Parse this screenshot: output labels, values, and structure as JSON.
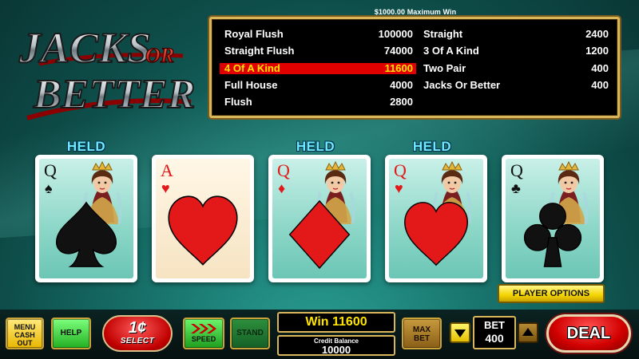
{
  "game": {
    "logo_line1": "JACKS",
    "logo_or": "OR",
    "logo_line2": "BETTER",
    "max_win": "$1000.00 Maximum Win"
  },
  "paytable": {
    "left": [
      {
        "hand": "Royal Flush",
        "payout": "100000"
      },
      {
        "hand": "Straight Flush",
        "payout": "74000"
      },
      {
        "hand": "4 Of A Kind",
        "payout": "11600",
        "highlighted": true
      },
      {
        "hand": "Full House",
        "payout": "4000"
      },
      {
        "hand": "Flush",
        "payout": "2800"
      }
    ],
    "right": [
      {
        "hand": "Straight",
        "payout": "2400"
      },
      {
        "hand": "3 Of A Kind",
        "payout": "1200"
      },
      {
        "hand": "Two Pair",
        "payout": "400"
      },
      {
        "hand": "Jacks Or Better",
        "payout": "400"
      }
    ],
    "highlight_color": "#e00000",
    "highlight_text_color": "#ffe400"
  },
  "held_label": "HELD",
  "cards": [
    {
      "rank": "Q",
      "suit": "spade-icon",
      "suit_glyph": "♠",
      "color": "black",
      "held": true,
      "face": true
    },
    {
      "rank": "A",
      "suit": "heart-icon",
      "suit_glyph": "♥",
      "color": "red",
      "held": false,
      "face": false
    },
    {
      "rank": "Q",
      "suit": "diamond-icon",
      "suit_glyph": "♦",
      "color": "red",
      "held": true,
      "face": true
    },
    {
      "rank": "Q",
      "suit": "heart-icon",
      "suit_glyph": "♥",
      "color": "red",
      "held": true,
      "face": true
    },
    {
      "rank": "Q",
      "suit": "club-icon",
      "suit_glyph": "♣",
      "color": "black",
      "held": false,
      "face": true
    }
  ],
  "player_options_label": "PLAYER OPTIONS",
  "controls": {
    "menu_line1": "MENU",
    "menu_line2": "CASH",
    "menu_line3": "OUT",
    "help": "HELP",
    "denomination": "1¢",
    "select": "SELECT",
    "speed": "SPEED",
    "stand": "STAND",
    "win_label": "Win",
    "win_value": "11600",
    "credit_label": "Credit Balance",
    "credit_value": "10000",
    "maxbet_line1": "MAX",
    "maxbet_line2": "BET",
    "bet_label": "BET",
    "bet_value": "400",
    "deal": "DEAL"
  },
  "colors": {
    "felt": "#1a7a72",
    "gold_border": "#d9b65a",
    "held_text": "#6ee8ff",
    "deal_red": "#d10000"
  }
}
